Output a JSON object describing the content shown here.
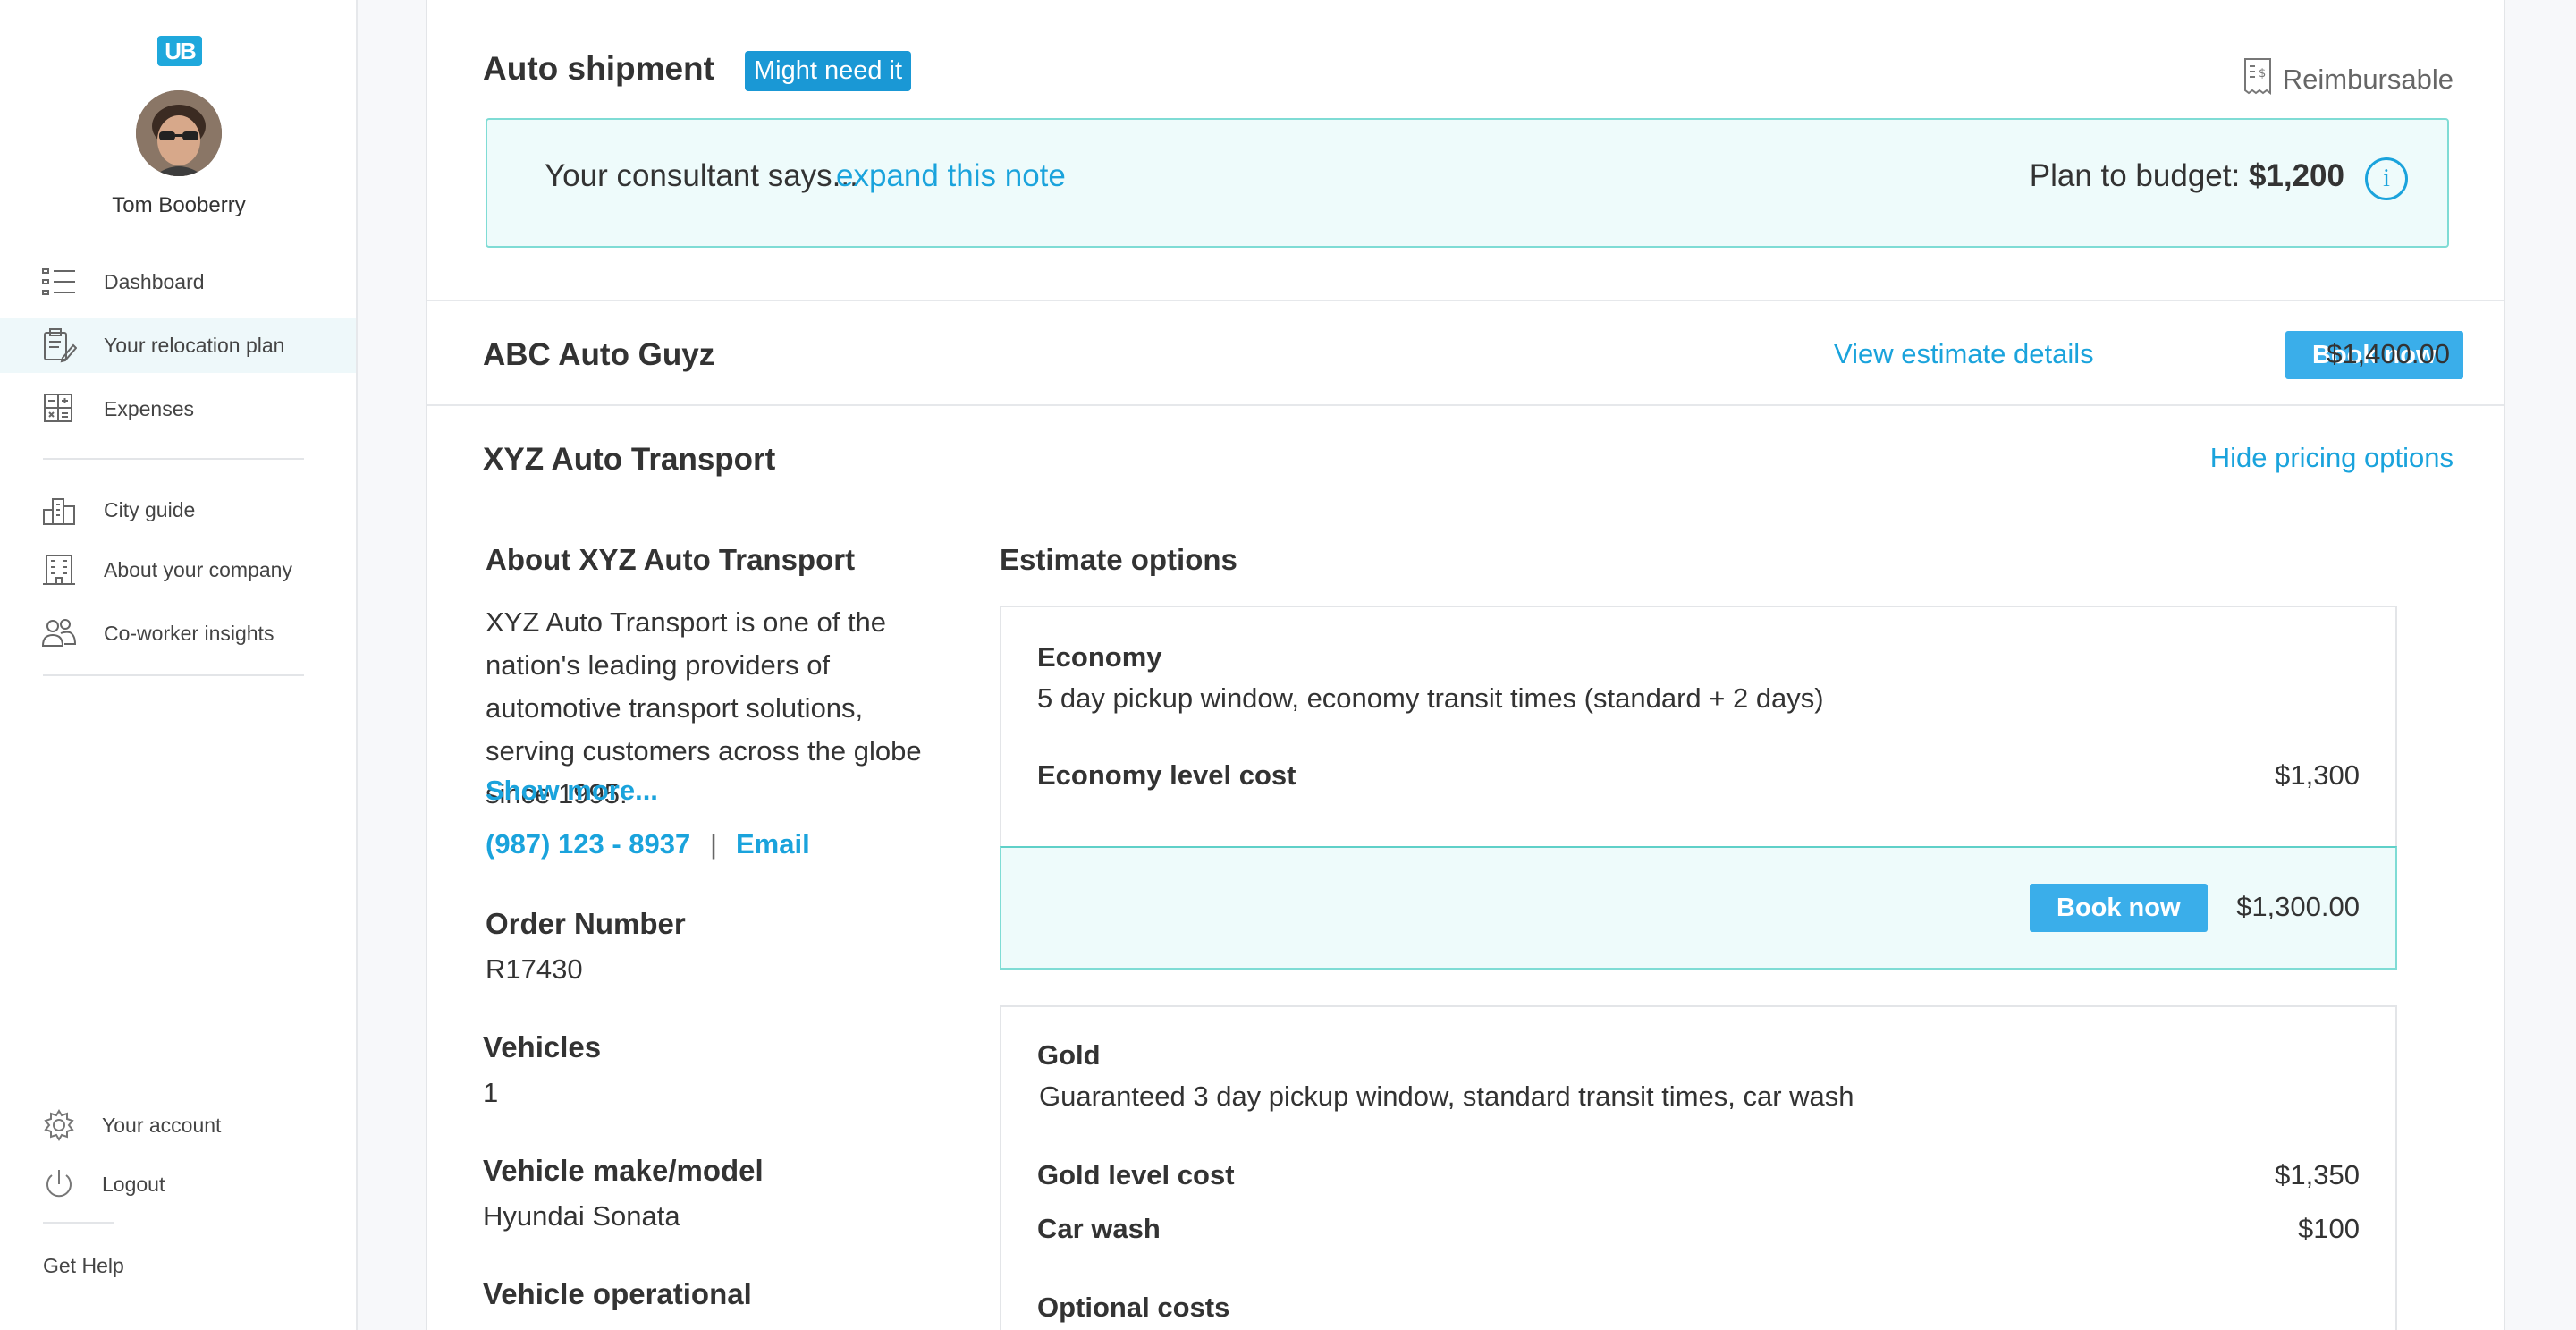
{
  "sidebar": {
    "logo": "UB",
    "user_name": "Tom Booberry",
    "nav": [
      {
        "label": "Dashboard"
      },
      {
        "label": "Your relocation plan"
      },
      {
        "label": "Expenses"
      },
      {
        "label": "City guide"
      },
      {
        "label": "About your company"
      },
      {
        "label": "Co-worker insights"
      }
    ],
    "account": "Your account",
    "logout": "Logout",
    "help": "Get Help"
  },
  "section": {
    "title": "Auto shipment",
    "badge": "Might need it",
    "reimbursable": "Reimbursable",
    "note_prefix": "Your consultant says...",
    "note_link": "expand this note",
    "budget_label": "Plan to budget: ",
    "budget_value": "$1,200",
    "info": "i"
  },
  "vendor1": {
    "name": "ABC Auto Guyz",
    "details_link": "View estimate details",
    "book": "Book now",
    "price": "$1,400.00"
  },
  "vendor2": {
    "name": "XYZ Auto Transport",
    "hide_link": "Hide pricing options",
    "about_heading": "About XYZ Auto Transport",
    "about_text": "XYZ Auto Transport is one of the nation's leading providers of automotive transport solutions, serving customers across the globe since 1995.",
    "show_more": "Show more...",
    "phone": "(987) 123 - 8937",
    "sep": "|",
    "email": "Email",
    "fields": [
      {
        "label": "Order Number",
        "value": "R17430"
      },
      {
        "label": "Vehicles",
        "value": "1"
      },
      {
        "label": "Vehicle make/model",
        "value": "Hyundai Sonata"
      },
      {
        "label": "Vehicle operational",
        "value": ""
      }
    ],
    "estimate_heading": "Estimate options",
    "options": [
      {
        "name": "Economy",
        "desc": "5 day pickup window, economy transit times (standard + 2 days)",
        "rows": [
          {
            "label": "Economy level cost",
            "value": "$1,300"
          }
        ],
        "book": "Book now",
        "total": "$1,300.00"
      },
      {
        "name": "Gold",
        "desc": "Guaranteed 3 day pickup window, standard transit times, car wash",
        "rows": [
          {
            "label": "Gold level cost",
            "value": "$1,350"
          },
          {
            "label": "Car wash",
            "value": "$100"
          }
        ],
        "optional": "Optional costs"
      }
    ]
  },
  "colors": {
    "accent": "#1aa3dc",
    "button": "#3aaeea",
    "badge": "#1a98d5",
    "note_bg": "#eefbfb",
    "note_border": "#7fdcd5"
  }
}
